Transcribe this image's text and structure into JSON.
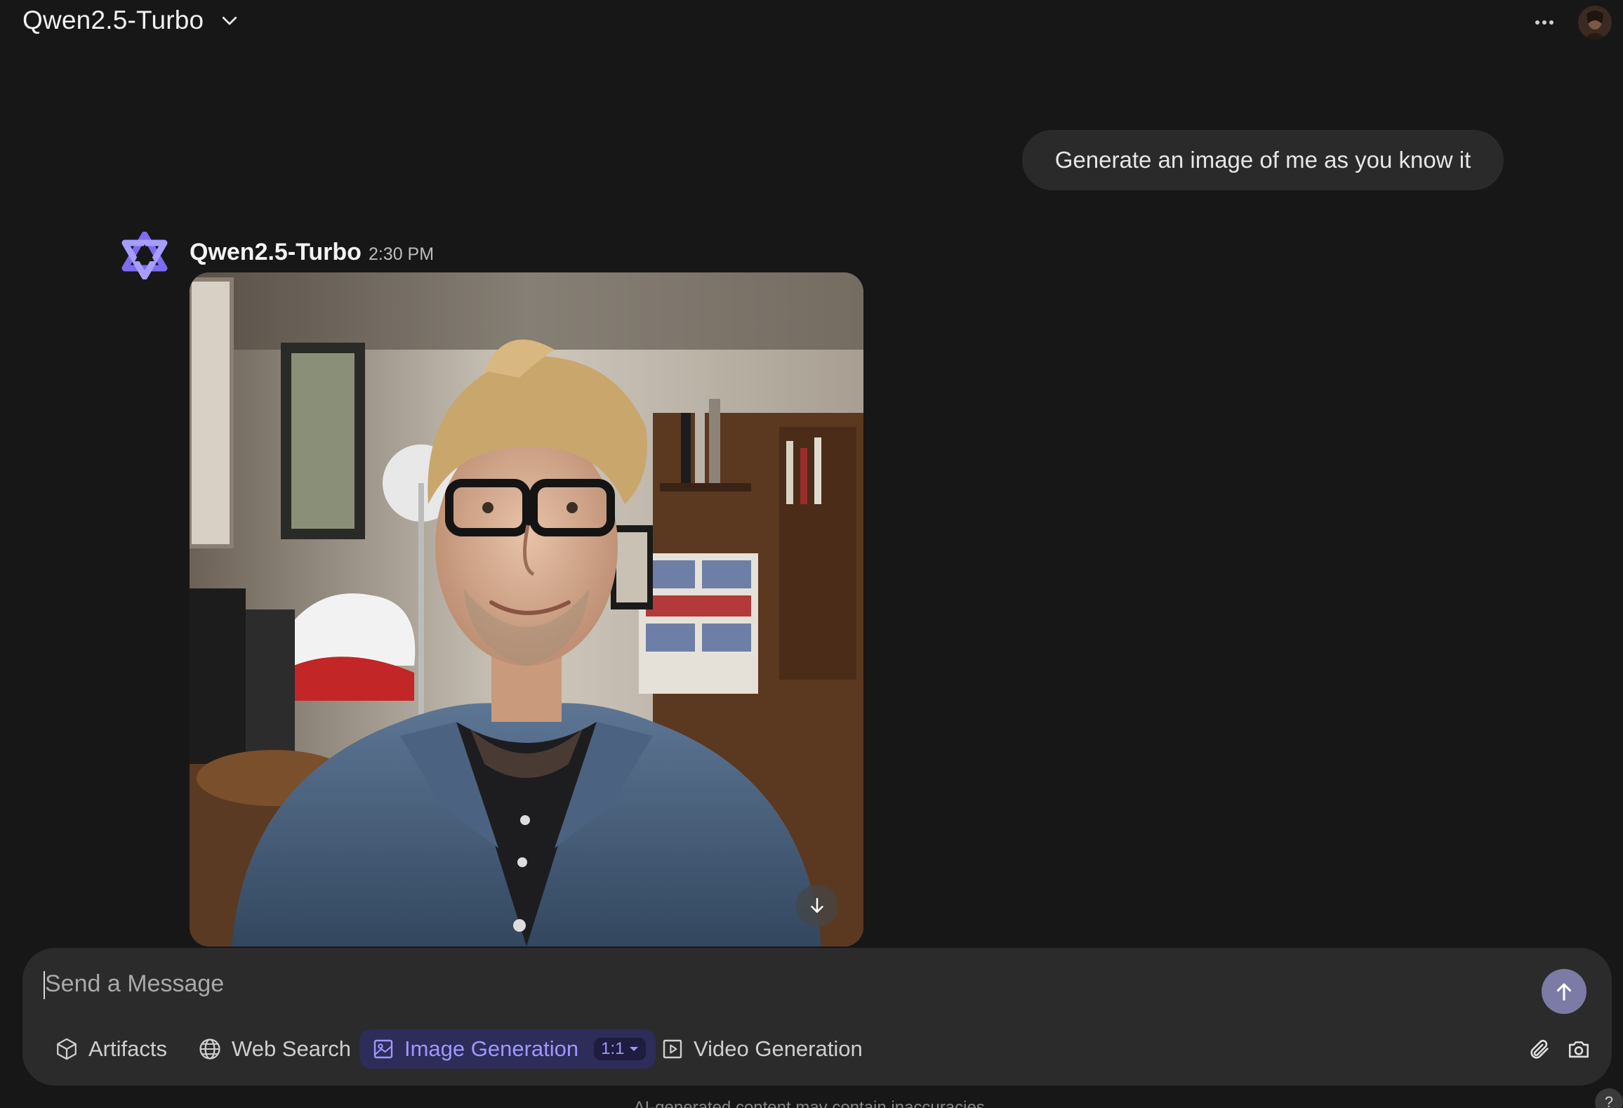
{
  "header": {
    "model_name": "Qwen2.5-Turbo",
    "more_icon": "ellipsis-icon",
    "avatar_icon": "user-avatar"
  },
  "conversation": {
    "user_message": "Generate an image of me as you know it",
    "assistant": {
      "name": "Qwen2.5-Turbo",
      "time": "2:30 PM",
      "logo_icon": "qwen-logo-icon",
      "image_description_icon": "generated-image",
      "download_icon": "arrow-down-icon"
    }
  },
  "composer": {
    "placeholder": "Send a Message",
    "send_icon": "arrow-up-icon",
    "tools": {
      "artifacts": "Artifacts",
      "web_search": "Web Search",
      "image_generation": "Image Generation",
      "aspect_ratio": "1:1",
      "video_generation": "Video Generation"
    },
    "attach_icon": "paperclip-icon",
    "camera_icon": "camera-icon"
  },
  "footer": {
    "disclaimer": "AI-generated content may contain inaccuracies.",
    "help_label": "?"
  },
  "colors": {
    "background": "#171717",
    "bubble": "#2a2a2a",
    "composer": "#2b2b2b",
    "accent": "#9d98ff",
    "accent_bg": "#2e2c58",
    "send_button": "#7b7ba6",
    "logo": "#6c5ce7"
  }
}
